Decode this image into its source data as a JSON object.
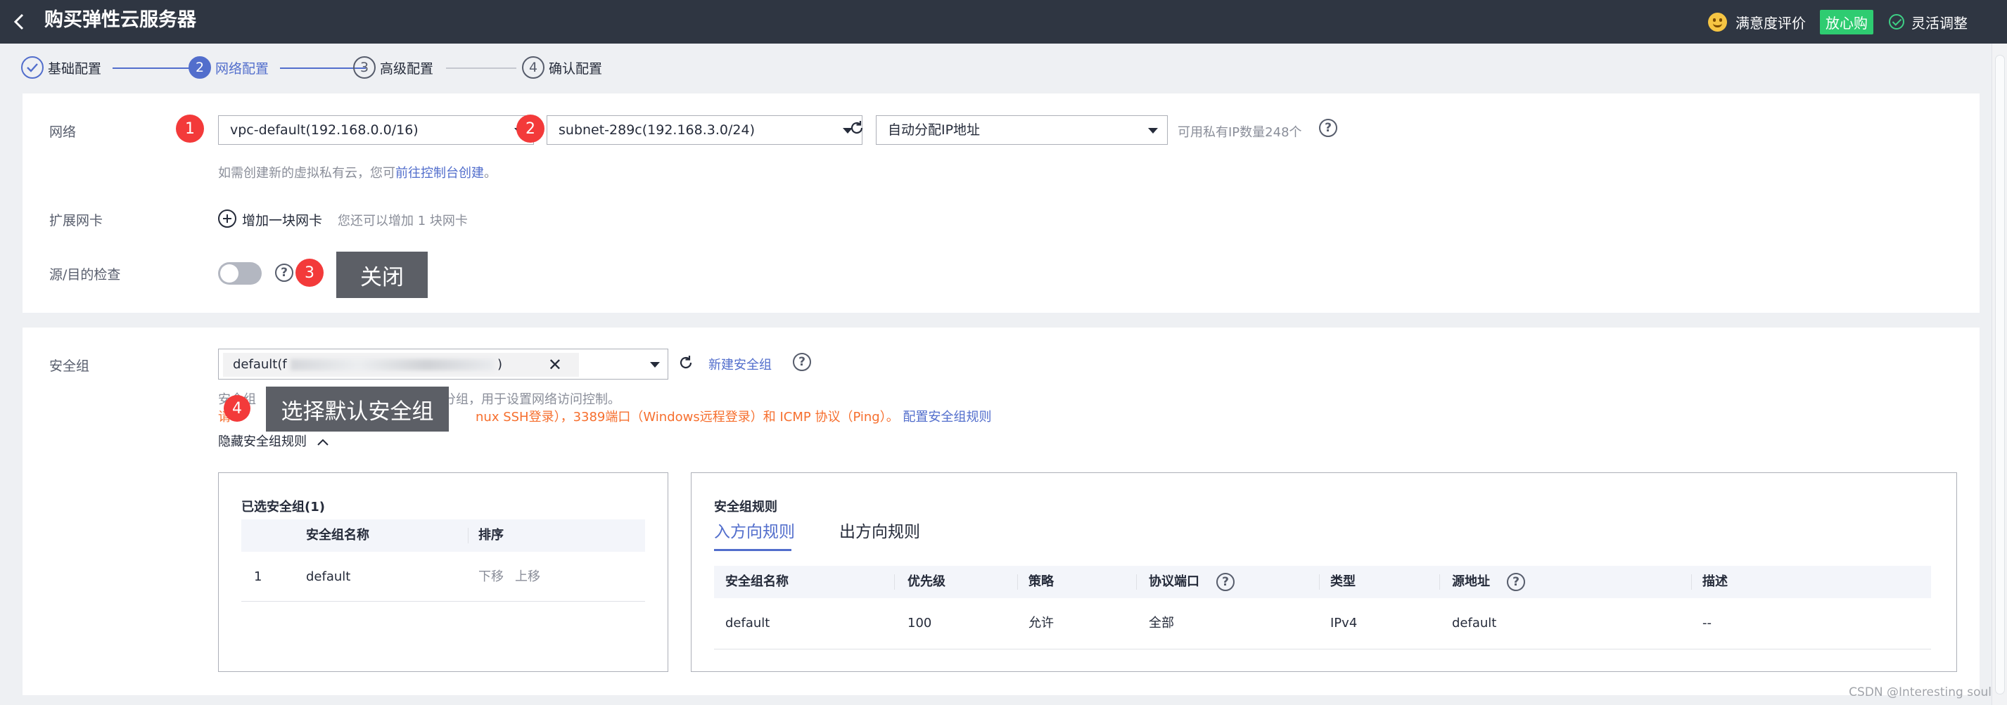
{
  "header": {
    "title": "购买弹性云服务器",
    "satisfaction": "满意度评价",
    "fxg_badge": "放心购",
    "flex_adjust": "灵活调整"
  },
  "steps": [
    {
      "num": "1",
      "label": "基础配置",
      "state": "done"
    },
    {
      "num": "2",
      "label": "网络配置",
      "state": "active"
    },
    {
      "num": "3",
      "label": "高级配置",
      "state": "pending"
    },
    {
      "num": "4",
      "label": "确认配置",
      "state": "pending"
    }
  ],
  "network": {
    "label": "网络",
    "vpc": "vpc-default(192.168.0.0/16)",
    "subnet": "subnet-289c(192.168.3.0/24)",
    "ip_mode": "自动分配IP地址",
    "available_ip": "可用私有IP数量248个",
    "hint_prefix": "如需创建新的虚拟私有云，您可",
    "hint_link": "前往控制台创建",
    "hint_suffix": "。"
  },
  "nic": {
    "label": "扩展网卡",
    "add_label": "增加一块网卡",
    "remain": "您还可以增加 1 块网卡"
  },
  "src_dst": {
    "label": "源/目的检查",
    "switch_on": false
  },
  "annotations": {
    "b1": "1",
    "b2": "2",
    "b3": "3",
    "b4": "4",
    "tip3": "关闭",
    "tip4": "选择默认安全组"
  },
  "secgroup": {
    "label": "安全组",
    "chip_prefix": "default(f",
    "chip_suffix": ")",
    "new_label": "新建安全组",
    "desc_visible_a": "安全组",
    "desc_visible_b": "上的分组，用于设置网络访问控制。",
    "warn_visible_a": "请",
    "warn_visible_b": "nux SSH登录），3389端口（Windows远程登录）和 ICMP 协议（Ping）。",
    "config_link": "配置安全组规则",
    "toggle_rules": "隐藏安全组规则"
  },
  "selected_groups": {
    "title": "已选安全组(1)",
    "columns": [
      "安全组名称",
      "排序"
    ],
    "rows": [
      {
        "idx": "1",
        "name": "default",
        "down": "下移",
        "up": "上移"
      }
    ]
  },
  "rules": {
    "title": "安全组规则",
    "tabs": [
      "入方向规则",
      "出方向规则"
    ],
    "columns": [
      "安全组名称",
      "优先级",
      "策略",
      "协议端口",
      "类型",
      "源地址",
      "描述"
    ],
    "rows": [
      {
        "group": "default",
        "priority": "100",
        "policy": "允许",
        "port": "全部",
        "type": "IPv4",
        "source": "default",
        "desc": "--"
      }
    ]
  },
  "watermark": "CSDN @Interesting soul",
  "colors": {
    "topbar": "#2f3642",
    "accent": "#526ecc",
    "badge": "#f33a3a",
    "warn": "#f66f2e"
  }
}
